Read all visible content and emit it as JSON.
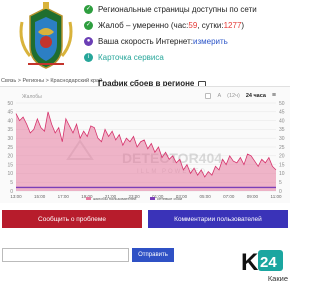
{
  "header": {
    "breadcrumb": "Связь > Регионы > Краснодарский край",
    "graph_heading": "График сбоев в регионе"
  },
  "status": {
    "pages": "Региональные страницы доступны по сети",
    "complaints_prefix": "Жалоб – умеренно (час: ",
    "complaints_hour": "59",
    "complaints_mid": ", сутки: ",
    "complaints_day": "1277",
    "complaints_suffix": ")",
    "speed_label": "Ваша скорость Интернет: ",
    "speed_link": "измерить",
    "service_card": "Карточка сервиса"
  },
  "toolbar": {
    "left_label": "Жалобы",
    "option_a": "А",
    "option_12": "(12ч)",
    "option_24": "24 часа",
    "menu_icon": "hamburger-menu-icon"
  },
  "watermark": {
    "title": "DETECTOR404",
    "subtitle": "ILLM POWERED"
  },
  "actions": {
    "report": "Сообщить о проблеме",
    "comments": "Комментарии пользователей"
  },
  "comment_box": {
    "placeholder": "",
    "send": "Отправить"
  },
  "footer": {
    "text": "Какие",
    "logo_k": "K",
    "logo_num": "24"
  },
  "colors": {
    "series_fill": "#e57a9f",
    "series_line": "#d6336c",
    "baseline": "#7b3fb8",
    "report_btn": "#b71c2c",
    "comments_btn": "#3a33b8",
    "send_btn": "#2f51c5"
  },
  "chart_data": {
    "type": "area",
    "x_ticks": [
      "13:00",
      "15:00",
      "17:00",
      "19:00",
      "21:00",
      "23:00",
      "01:00",
      "03:00",
      "05:00",
      "07:00",
      "09:00",
      "11:00"
    ],
    "ylim": [
      0,
      50
    ],
    "y_ticks": [
      0,
      5,
      10,
      15,
      20,
      25,
      30,
      35,
      40,
      45,
      50
    ],
    "grid": true,
    "legend_position": "bottom",
    "series": [
      {
        "name": "жалобы пользователей",
        "values": [
          44,
          40,
          42,
          38,
          33,
          35,
          41,
          36,
          34,
          45,
          38,
          33,
          36,
          28,
          41,
          37,
          33,
          38,
          30,
          34,
          31,
          37,
          36,
          30,
          28,
          35,
          31,
          34,
          29,
          32,
          26,
          30,
          28,
          31,
          25,
          28,
          29,
          24,
          27,
          22,
          25,
          19,
          22,
          18,
          20,
          16,
          18,
          12,
          15,
          10,
          13,
          9,
          12,
          8,
          11,
          9,
          14,
          12,
          18,
          15,
          20,
          17,
          16,
          19,
          15,
          21,
          20,
          17,
          14,
          18,
          16,
          19,
          14,
          12
        ]
      },
      {
        "name": "сетевые сбои",
        "values": [
          2,
          2,
          2,
          2,
          2,
          2,
          2,
          2,
          2,
          2,
          2,
          2,
          2,
          2,
          2,
          2,
          2,
          2,
          2,
          2,
          2,
          2,
          2,
          2,
          2,
          2,
          2,
          2,
          2,
          2,
          2,
          2,
          2,
          2,
          2,
          2,
          2,
          2,
          2,
          2,
          2,
          2,
          2,
          2,
          2,
          2,
          2,
          2,
          2,
          2,
          2,
          2,
          2,
          2,
          2,
          2,
          2,
          2,
          2,
          2,
          2,
          2,
          2,
          2,
          2,
          2,
          2,
          2,
          2,
          2,
          2,
          2,
          2,
          2
        ]
      }
    ]
  }
}
